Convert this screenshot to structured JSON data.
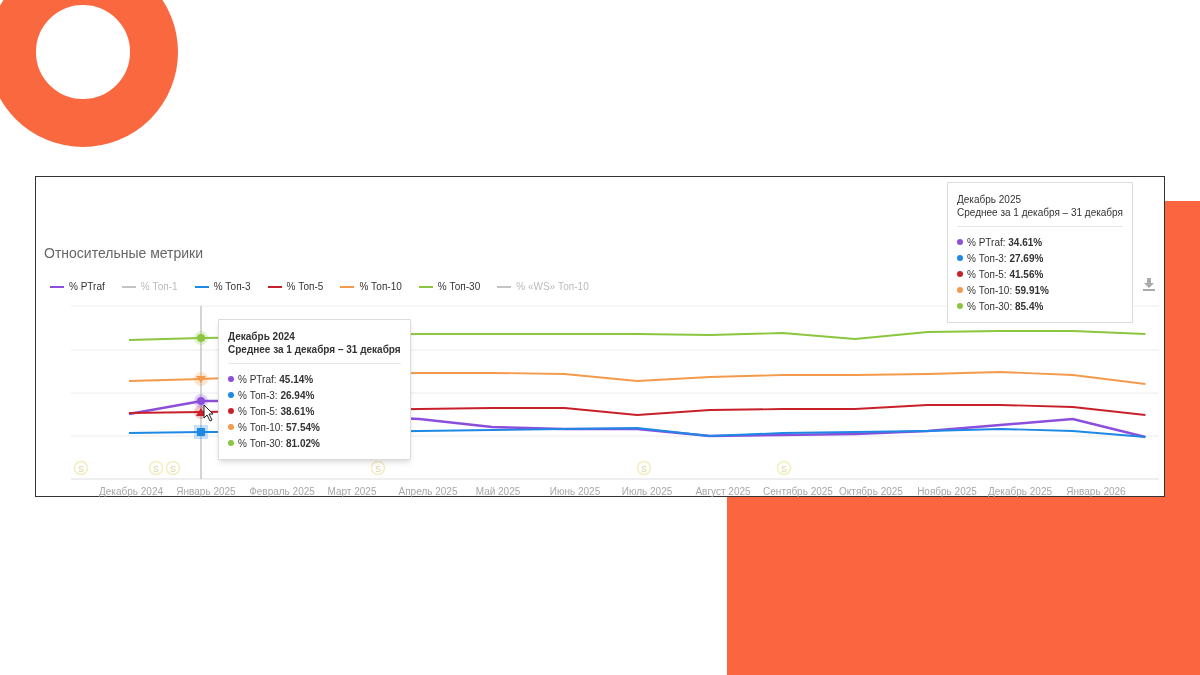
{
  "panel": {
    "title": "Относительные метрики",
    "legend": [
      {
        "label": "% PTraf",
        "enabled": true,
        "color": "#8b4fdc"
      },
      {
        "label": "% Топ-1",
        "enabled": false
      },
      {
        "label": "% Топ-3",
        "enabled": true,
        "color": "#1e88e5"
      },
      {
        "label": "% Топ-5",
        "enabled": true,
        "color": "#c8202a"
      },
      {
        "label": "% Топ-10",
        "enabled": true,
        "color": "#f39a4c"
      },
      {
        "label": "% Топ-30",
        "enabled": true,
        "color": "#8cc63f"
      },
      {
        "label": "% «WS» Топ-10",
        "enabled": false
      }
    ],
    "x_labels": [
      "Декабрь 2024",
      "Январь 2025",
      "Февраль 2025",
      "Март 2025",
      "Апрель 2025",
      "Май 2025",
      "Июнь 2025",
      "Июль 2025",
      "Август 2025",
      "Сентябрь 2025",
      "Октябрь 2025",
      "Ноябрь 2025",
      "Декабрь 2025",
      "Январь 2026"
    ],
    "event_markers": [
      "S",
      "S",
      "S",
      "S",
      "S",
      "S"
    ],
    "tooltips": [
      {
        "title": "Декабрь 2024",
        "subtitle": "Среднее за 1 декабря – 31 декабря",
        "items": [
          {
            "text": "% PTraf: **45.14%**",
            "color": "#8b4fdc"
          },
          {
            "text": "% Топ-3: **26.94%**",
            "color": "#1e88e5"
          },
          {
            "text": "% Топ-5: **38.61%**",
            "color": "#c8202a"
          },
          {
            "text": "% Топ-10: **57.54%**",
            "color": "#f39a4c"
          },
          {
            "text": "% Топ-30: **81.02%**",
            "color": "#8cc63f"
          }
        ]
      },
      {
        "title": "Декабрь 2025",
        "subtitle": "Среднее за 1 декабря – 31 декабря",
        "items": [
          {
            "text": "% PTraf: **34.61%**",
            "color": "#8b4fdc"
          },
          {
            "text": "% Топ-3: **27.69%**",
            "color": "#1e88e5"
          },
          {
            "text": "% Топ-5: **41.56%**",
            "color": "#c8202a"
          },
          {
            "text": "% Топ-10: **59.91%**",
            "color": "#f39a4c"
          },
          {
            "text": "% Топ-30: **85.4%**",
            "color": "#8cc63f"
          }
        ]
      }
    ]
  }
}
